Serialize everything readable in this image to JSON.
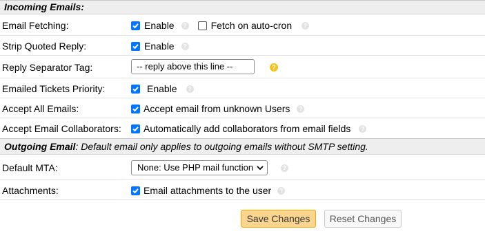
{
  "incoming": {
    "title": "Incoming Emails:",
    "email_fetching": {
      "label": "Email Fetching:",
      "enable": "Enable",
      "enable_checked": true,
      "fetch": "Fetch on auto-cron",
      "fetch_checked": false
    },
    "strip_quoted": {
      "label": "Strip Quoted Reply:",
      "enable": "Enable",
      "checked": true
    },
    "reply_separator": {
      "label": "Reply Separator Tag:",
      "value": "-- reply above this line --"
    },
    "emailed_priority": {
      "label": "Emailed Tickets Priority:",
      "enable": "Enable",
      "checked": true
    },
    "accept_all": {
      "label": "Accept All Emails:",
      "text": "Accept email from unknown Users",
      "checked": true
    },
    "accept_collab": {
      "label": "Accept Email Collaborators:",
      "text": "Automatically add collaborators from email fields",
      "checked": true
    }
  },
  "outgoing": {
    "title": "Outgoing Email",
    "note": ": Default email only applies to outgoing emails without SMTP setting.",
    "default_mta": {
      "label": "Default MTA:",
      "selected": "None: Use PHP mail function"
    },
    "attachments": {
      "label": "Attachments:",
      "text": "Email attachments to the user",
      "checked": true
    }
  },
  "actions": {
    "save": "Save Changes",
    "reset": "Reset Changes"
  },
  "colors": {
    "checkbox": "#0075ff",
    "help_icon": "#e3e3e3",
    "warn_icon": "#f7c31a",
    "save_bg": "#fbd58d",
    "header_bg": "#eeeeee"
  },
  "icons": {
    "help": "help-icon",
    "warning": "warning-help-icon",
    "check": "check-icon",
    "dropdown": "chevron-down-icon"
  }
}
